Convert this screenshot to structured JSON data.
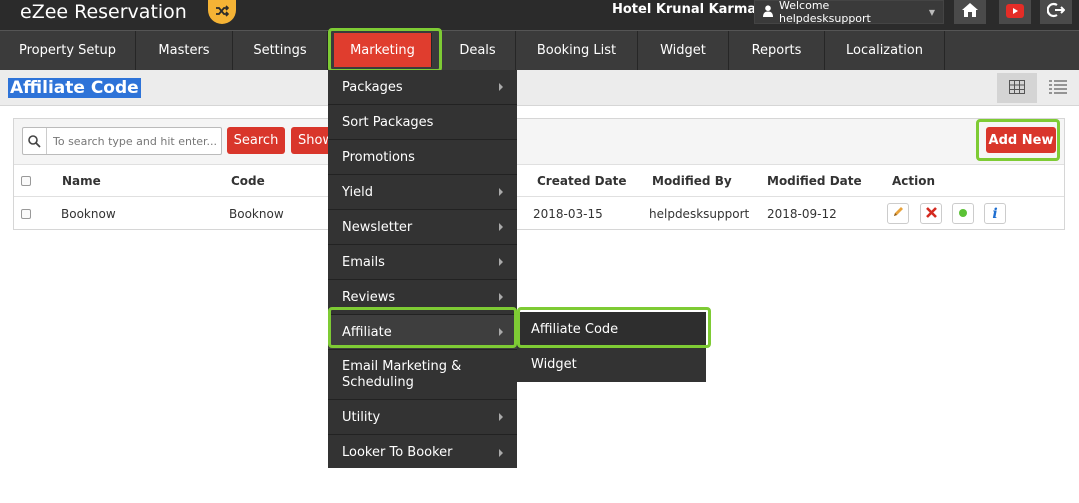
{
  "header": {
    "app_title": "eZee Reservation",
    "hotel_name": "Hotel Krunal Karma",
    "welcome_text": "Welcome helpdesksupport"
  },
  "nav": {
    "tabs": [
      {
        "label": "Property Setup"
      },
      {
        "label": "Masters"
      },
      {
        "label": "Settings"
      },
      {
        "label": "Marketing",
        "active": true
      },
      {
        "label": "Deals"
      },
      {
        "label": "Booking List"
      },
      {
        "label": "Widget"
      },
      {
        "label": "Reports"
      },
      {
        "label": "Localization"
      }
    ]
  },
  "page": {
    "title": "Affiliate Code"
  },
  "toolbar": {
    "search_placeholder": "To search type and hit enter...",
    "search_label": "Search",
    "show_label": "Show",
    "add_new_label": "Add New"
  },
  "table": {
    "headers": [
      "Name",
      "Code",
      "Created Date",
      "Modified By",
      "Modified Date",
      "Action"
    ],
    "rows": [
      {
        "name": "Booknow",
        "code": "Booknow",
        "created": "2018-03-15",
        "modified_by": "helpdesksupport",
        "modified_date": "2018-09-12"
      }
    ]
  },
  "marketing_menu": {
    "items": [
      {
        "label": "Packages",
        "has_sub": true
      },
      {
        "label": "Sort Packages",
        "has_sub": false
      },
      {
        "label": "Promotions",
        "has_sub": false
      },
      {
        "label": "Yield",
        "has_sub": true
      },
      {
        "label": "Newsletter",
        "has_sub": true
      },
      {
        "label": "Emails",
        "has_sub": true
      },
      {
        "label": "Reviews",
        "has_sub": true
      },
      {
        "label": "Affiliate",
        "has_sub": true
      },
      {
        "label": "Email Marketing &",
        "label2": "Scheduling",
        "has_sub": false
      },
      {
        "label": "Utility",
        "has_sub": true
      },
      {
        "label": "Looker To Booker",
        "has_sub": true
      }
    ]
  },
  "affiliate_submenu": {
    "items": [
      {
        "label": "Affiliate Code"
      },
      {
        "label": "Widget"
      }
    ]
  },
  "colors": {
    "accent_red": "#d9362b",
    "highlight_green": "#7ecb34",
    "nav_bg": "#3b3b3b",
    "shuffle_orange": "#f5b335"
  }
}
